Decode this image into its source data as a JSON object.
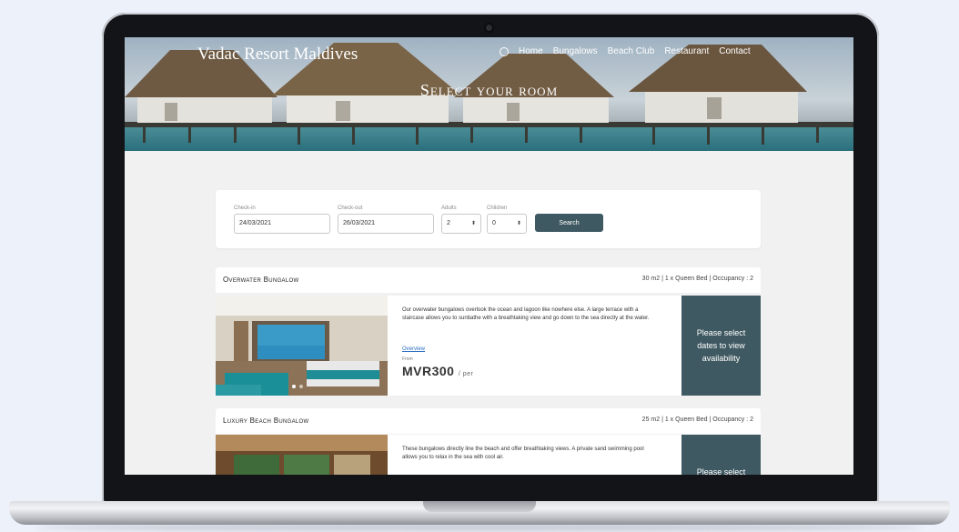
{
  "site": {
    "brand": "Vadac Resort Maldives",
    "nav": [
      "Home",
      "Bungalows",
      "Beach Club",
      "Restaurant",
      "Contact"
    ],
    "hero_title": "Select your room"
  },
  "search": {
    "checkin_label": "Check-in",
    "checkin_value": "24/03/2021",
    "checkout_label": "Check-out",
    "checkout_value": "26/03/2021",
    "adults_label": "Adults",
    "adults_value": "2",
    "children_label": "Children",
    "children_value": "0",
    "submit_label": "Search"
  },
  "rooms": [
    {
      "name": "Overwater Bungalow",
      "meta": "30 m2 | 1 x Queen Bed | Occupancy : 2",
      "description": "Our overwater bungalows overlook the ocean and lagoon like nowhere else. A large terrace with a staircase allows you to sunbathe with a breathtaking view and go down to the sea directly at the water.",
      "overview_link": "Overview",
      "from_label": "From",
      "price": "MVR300",
      "per_night": "/ per",
      "availability": "Please select dates to view availability"
    },
    {
      "name": "Luxury Beach Bungalow",
      "meta": "25 m2 | 1 x Queen Bed | Occupancy : 2",
      "description": "These bungalows directly line the beach and offer breathtaking views. A private sand swimming pool allows you to relax in the sea with cool air.",
      "availability": "Please select dates to view availability"
    }
  ],
  "colors": {
    "accent": "#3f5962",
    "page_bg": "#f1f1f1",
    "device_bg": "#edf1fa"
  }
}
